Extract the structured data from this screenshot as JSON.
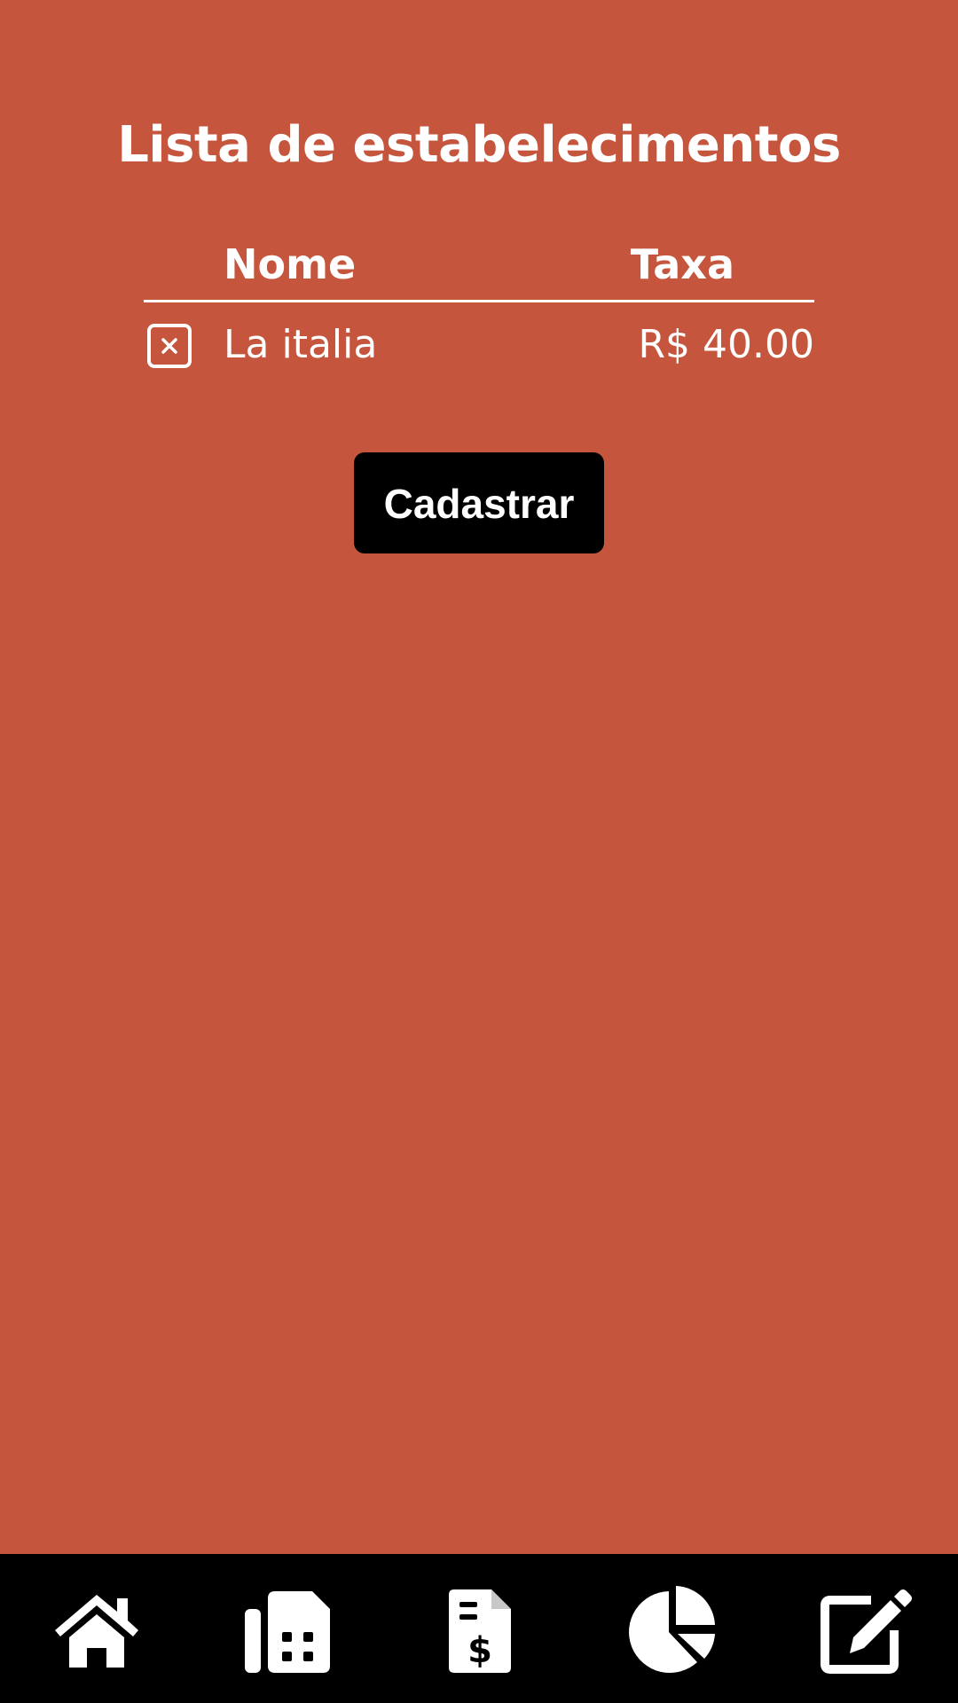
{
  "page": {
    "title": "Lista de estabelecimentos",
    "background_color": "#c5553c"
  },
  "table": {
    "headers": {
      "name": "Nome",
      "fee": "Taxa"
    },
    "rows": [
      {
        "name": "La italia",
        "fee": "R$ 40.00"
      }
    ]
  },
  "actions": {
    "register_label": "Cadastrar"
  },
  "bottom_nav": {
    "items": [
      {
        "icon": "home-icon"
      },
      {
        "icon": "cash-register-icon"
      },
      {
        "icon": "invoice-dollar-icon"
      },
      {
        "icon": "pie-chart-icon"
      },
      {
        "icon": "edit-icon"
      }
    ]
  }
}
